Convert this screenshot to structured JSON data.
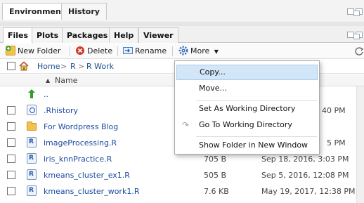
{
  "top_tabs": [
    "Environment",
    "History"
  ],
  "files_tabs": [
    "Files",
    "Plots",
    "Packages",
    "Help",
    "Viewer"
  ],
  "toolbar": {
    "new_folder": "New Folder",
    "delete": "Delete",
    "rename": "Rename",
    "more": "More"
  },
  "breadcrumb": [
    "Home",
    "R",
    "R Work"
  ],
  "header": {
    "name": "Name"
  },
  "rows": [
    {
      "name": "..",
      "size": "",
      "modified": "",
      "icon": "up-arrow-icon"
    },
    {
      "name": ".Rhistory",
      "size": "",
      "modified": "40 PM",
      "icon": "history-file-icon"
    },
    {
      "name": "For Wordpress Blog",
      "size": "",
      "modified": "",
      "icon": "folder-icon"
    },
    {
      "name": "imageProcessing.R",
      "size": "",
      "modified": "5 PM",
      "icon": "r-file-icon"
    },
    {
      "name": "iris_knnPractice.R",
      "size": "705 B",
      "modified": "Sep 18, 2016, 3:03 PM",
      "icon": "r-file-icon"
    },
    {
      "name": "kmeans_cluster_ex1.R",
      "size": "505 B",
      "modified": "Sep 5, 2016, 12:08 PM",
      "icon": "r-file-icon"
    },
    {
      "name": "kmeans_cluster_work1.R",
      "size": "7.6 KB",
      "modified": "May 19, 2017, 12:38 PM",
      "icon": "r-file-icon"
    }
  ],
  "menu": {
    "copy": "Copy...",
    "move": "Move...",
    "set_wd": "Set As Working Directory",
    "go_wd": "Go To Working Directory",
    "show_folder": "Show Folder in New Window"
  },
  "colors": {
    "link": "#1a4ba0",
    "menu_highlight": "#d2e6f7",
    "up_arrow": "#2e9e2e",
    "folder": "#f3c24a"
  }
}
